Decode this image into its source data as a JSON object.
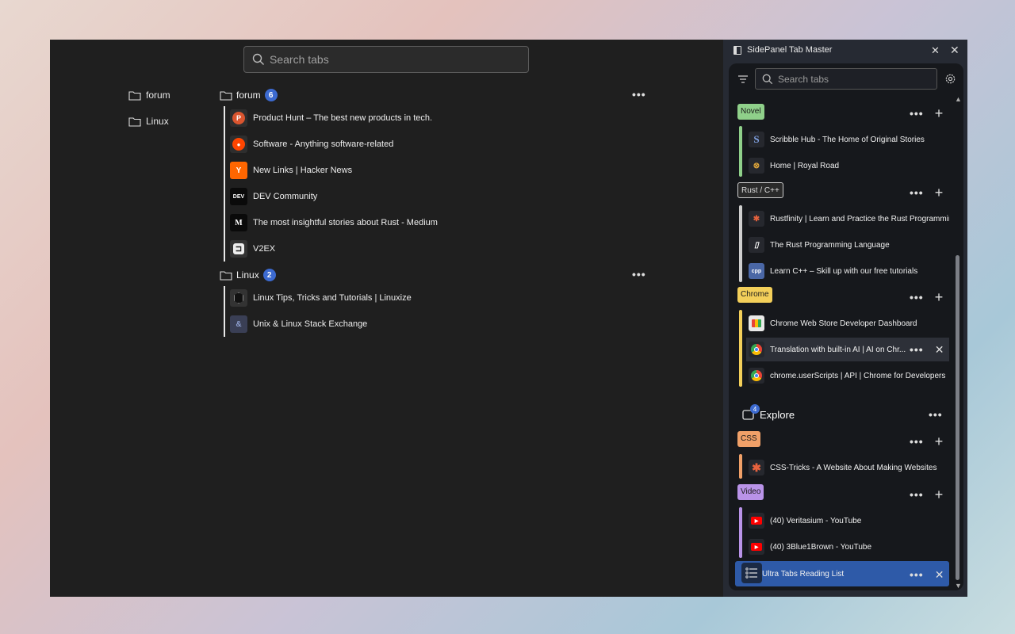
{
  "main": {
    "search": {
      "placeholder": "Search tabs"
    },
    "sidebar_folders": [
      {
        "label": "forum"
      },
      {
        "label": "Linux"
      }
    ],
    "groups": [
      {
        "name": "forum",
        "count": "6",
        "tabs": [
          {
            "title": "Product Hunt – The best new products in tech.",
            "icon": "P",
            "color": "#da552f"
          },
          {
            "title": "Software - Anything software-related",
            "icon": "reddit",
            "color": "#ff4500"
          },
          {
            "title": "New Links | Hacker News",
            "icon": "Y",
            "color": "#ff6600"
          },
          {
            "title": "DEV Community",
            "icon": "DEV",
            "color": "#0a0a0a"
          },
          {
            "title": "The most insightful stories about Rust - Medium",
            "icon": "M",
            "color": "#0a0a0a"
          },
          {
            "title": "V2EX",
            "icon": "V",
            "color": "#333333"
          }
        ]
      },
      {
        "name": "Linux",
        "count": "2",
        "tabs": [
          {
            "title": "Linux Tips, Tricks and Tutorials | Linuxize",
            "icon": "L",
            "color": "#333333"
          },
          {
            "title": "Unix & Linux Stack Exchange",
            "icon": "&",
            "color": "#3a3f55"
          }
        ]
      }
    ]
  },
  "panel": {
    "title": "SidePanel Tab Master",
    "search": {
      "placeholder": "Search tabs"
    },
    "groups": [
      {
        "label": "Novel",
        "color": "#8fd08a",
        "tabs": [
          {
            "title": "Scribble Hub - The Home of Original Stories",
            "icon": "S",
            "color": "#1d2a44"
          },
          {
            "title": "Home | Royal Road",
            "icon": "R",
            "color": "#c99a2e"
          }
        ]
      },
      {
        "label": "Rust / C++",
        "color": "#cfcfcf",
        "tabs": [
          {
            "title": "Rustfinity | Learn and Practice the Rust Programming ...",
            "icon": "crab",
            "color": "#e2613d"
          },
          {
            "title": "The Rust Programming Language",
            "icon": "book",
            "color": "#555555"
          },
          {
            "title": "Learn C++ – Skill up with our free tutorials",
            "icon": "cpp",
            "color": "#4a67a6"
          }
        ]
      },
      {
        "label": "Chrome",
        "color": "#f3cf5a",
        "tabs": [
          {
            "title": "Chrome Web Store Developer Dashboard",
            "icon": "store",
            "color": "#e9e9e9"
          },
          {
            "title": "Translation with built-in AI  |  AI on Chr...",
            "icon": "chrome",
            "color": "#4285f4"
          },
          {
            "title": "chrome.userScripts  |  API  |  Chrome for Developers",
            "icon": "chrome",
            "color": "#4285f4"
          }
        ]
      }
    ],
    "workspace": {
      "name": "Explore",
      "count": "4"
    },
    "explore_groups": [
      {
        "label": "CSS",
        "color": "#f0a068",
        "tabs": [
          {
            "title": "CSS-Tricks - A Website About Making Websites",
            "icon": "*",
            "color": "#e8623e"
          }
        ]
      },
      {
        "label": "Video",
        "color": "#b993e8",
        "tabs": [
          {
            "title": "(40) Veritasium - YouTube",
            "icon": "yt",
            "color": "#ff0000"
          },
          {
            "title": "(40) 3Blue1Brown - YouTube",
            "icon": "yt",
            "color": "#ff0000"
          }
        ]
      }
    ],
    "active_tab": {
      "title": "Ultra Tabs Reading List"
    },
    "icons": {
      "search": "search-icon",
      "filter": "filter-icon",
      "gear": "gear-icon",
      "pin": "pin-off-icon",
      "close": "close-icon",
      "more": "more-icon",
      "add": "plus-icon",
      "reading_list": "list-icon"
    }
  }
}
